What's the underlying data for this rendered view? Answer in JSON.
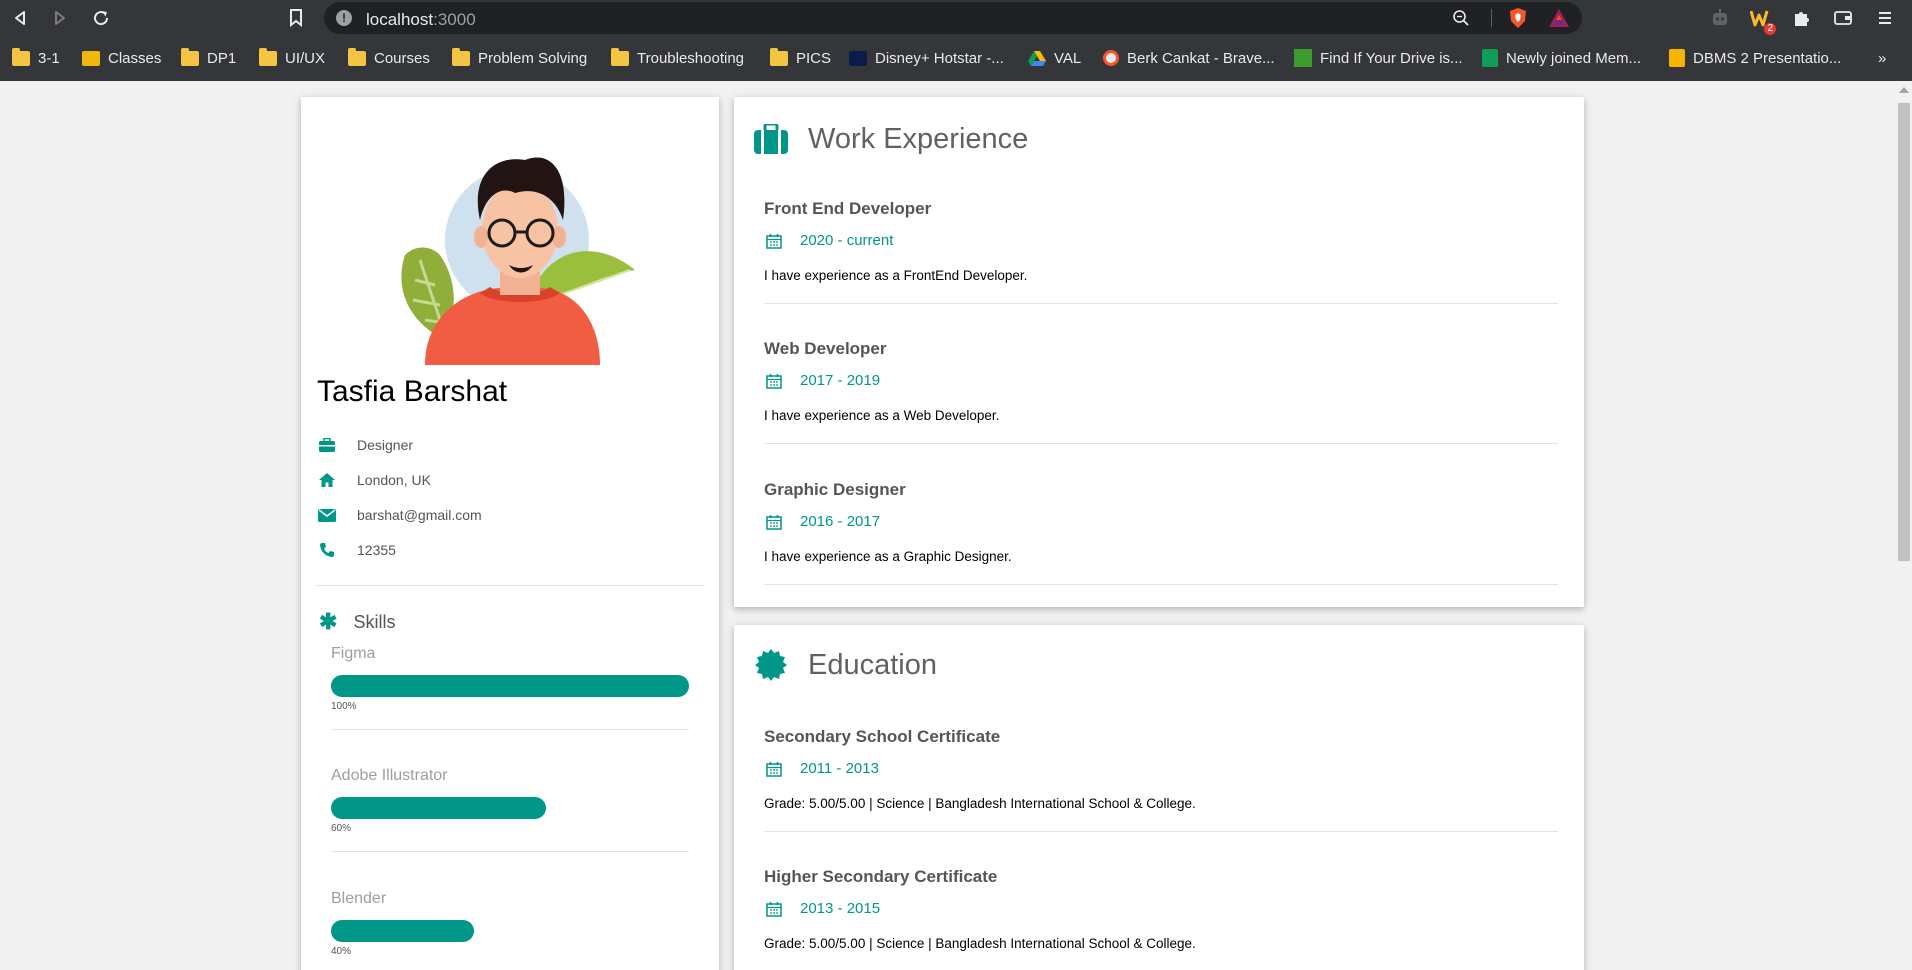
{
  "browser": {
    "url_host": "localhost",
    "url_port": ":3000",
    "bookmarks": [
      {
        "label": "3-1",
        "icon": "folder-icon"
      },
      {
        "label": "Classes",
        "icon": "classroom-icon"
      },
      {
        "label": "DP1",
        "icon": "folder-icon"
      },
      {
        "label": "UI/UX",
        "icon": "folder-icon"
      },
      {
        "label": "Courses",
        "icon": "folder-icon"
      },
      {
        "label": "Problem Solving",
        "icon": "folder-icon"
      },
      {
        "label": "Troubleshooting",
        "icon": "folder-icon"
      },
      {
        "label": "PICS",
        "icon": "folder-icon"
      },
      {
        "label": "Disney+ Hotstar -...",
        "icon": "hotstar-icon"
      },
      {
        "label": "VAL",
        "icon": "drive-icon"
      },
      {
        "label": "Berk Cankat - Brave...",
        "icon": "brave-icon"
      },
      {
        "label": "Find If Your Drive is...",
        "icon": "site-icon"
      },
      {
        "label": "Newly joined Mem...",
        "icon": "sheets-icon"
      },
      {
        "label": "DBMS 2 Presentatio...",
        "icon": "slides-icon"
      }
    ],
    "ext_badge": "2",
    "more_bookmarks": "»"
  },
  "profile": {
    "name": "Tasfia Barshat",
    "job": "Designer",
    "location": "London, UK",
    "email": "barshat@gmail.com",
    "phone": "12355",
    "skills_title": "Skills",
    "skills": [
      {
        "name": "Figma",
        "percent_label": "100%",
        "level": 1.0
      },
      {
        "name": "Adobe Illustrator",
        "percent_label": "60%",
        "level": 0.6
      },
      {
        "name": "Blender",
        "percent_label": "40%",
        "level": 0.4
      }
    ]
  },
  "work": {
    "title": "Work Experience",
    "entries": [
      {
        "title": "Front End Developer",
        "date": "2020 - current",
        "desc": "I have experience as a FrontEnd Developer."
      },
      {
        "title": "Web Developer",
        "date": "2017 - 2019",
        "desc": "I have experience as a Web Developer."
      },
      {
        "title": "Graphic Designer",
        "date": "2016 - 2017",
        "desc": "I have experience as a Graphic Designer."
      }
    ]
  },
  "education": {
    "title": "Education",
    "entries": [
      {
        "title": "Secondary School Certificate",
        "date": "2011 - 2013",
        "desc": "Grade: 5.00/5.00 | Science | Bangladesh International School & College."
      },
      {
        "title": "Higher Secondary Certificate",
        "date": "2013 - 2015",
        "desc": "Grade: 5.00/5.00 | Science | Bangladesh International School & College."
      }
    ]
  },
  "colors": {
    "accent": "#009688",
    "chrome": "#35363a",
    "page_bg": "#f1f1f1"
  }
}
